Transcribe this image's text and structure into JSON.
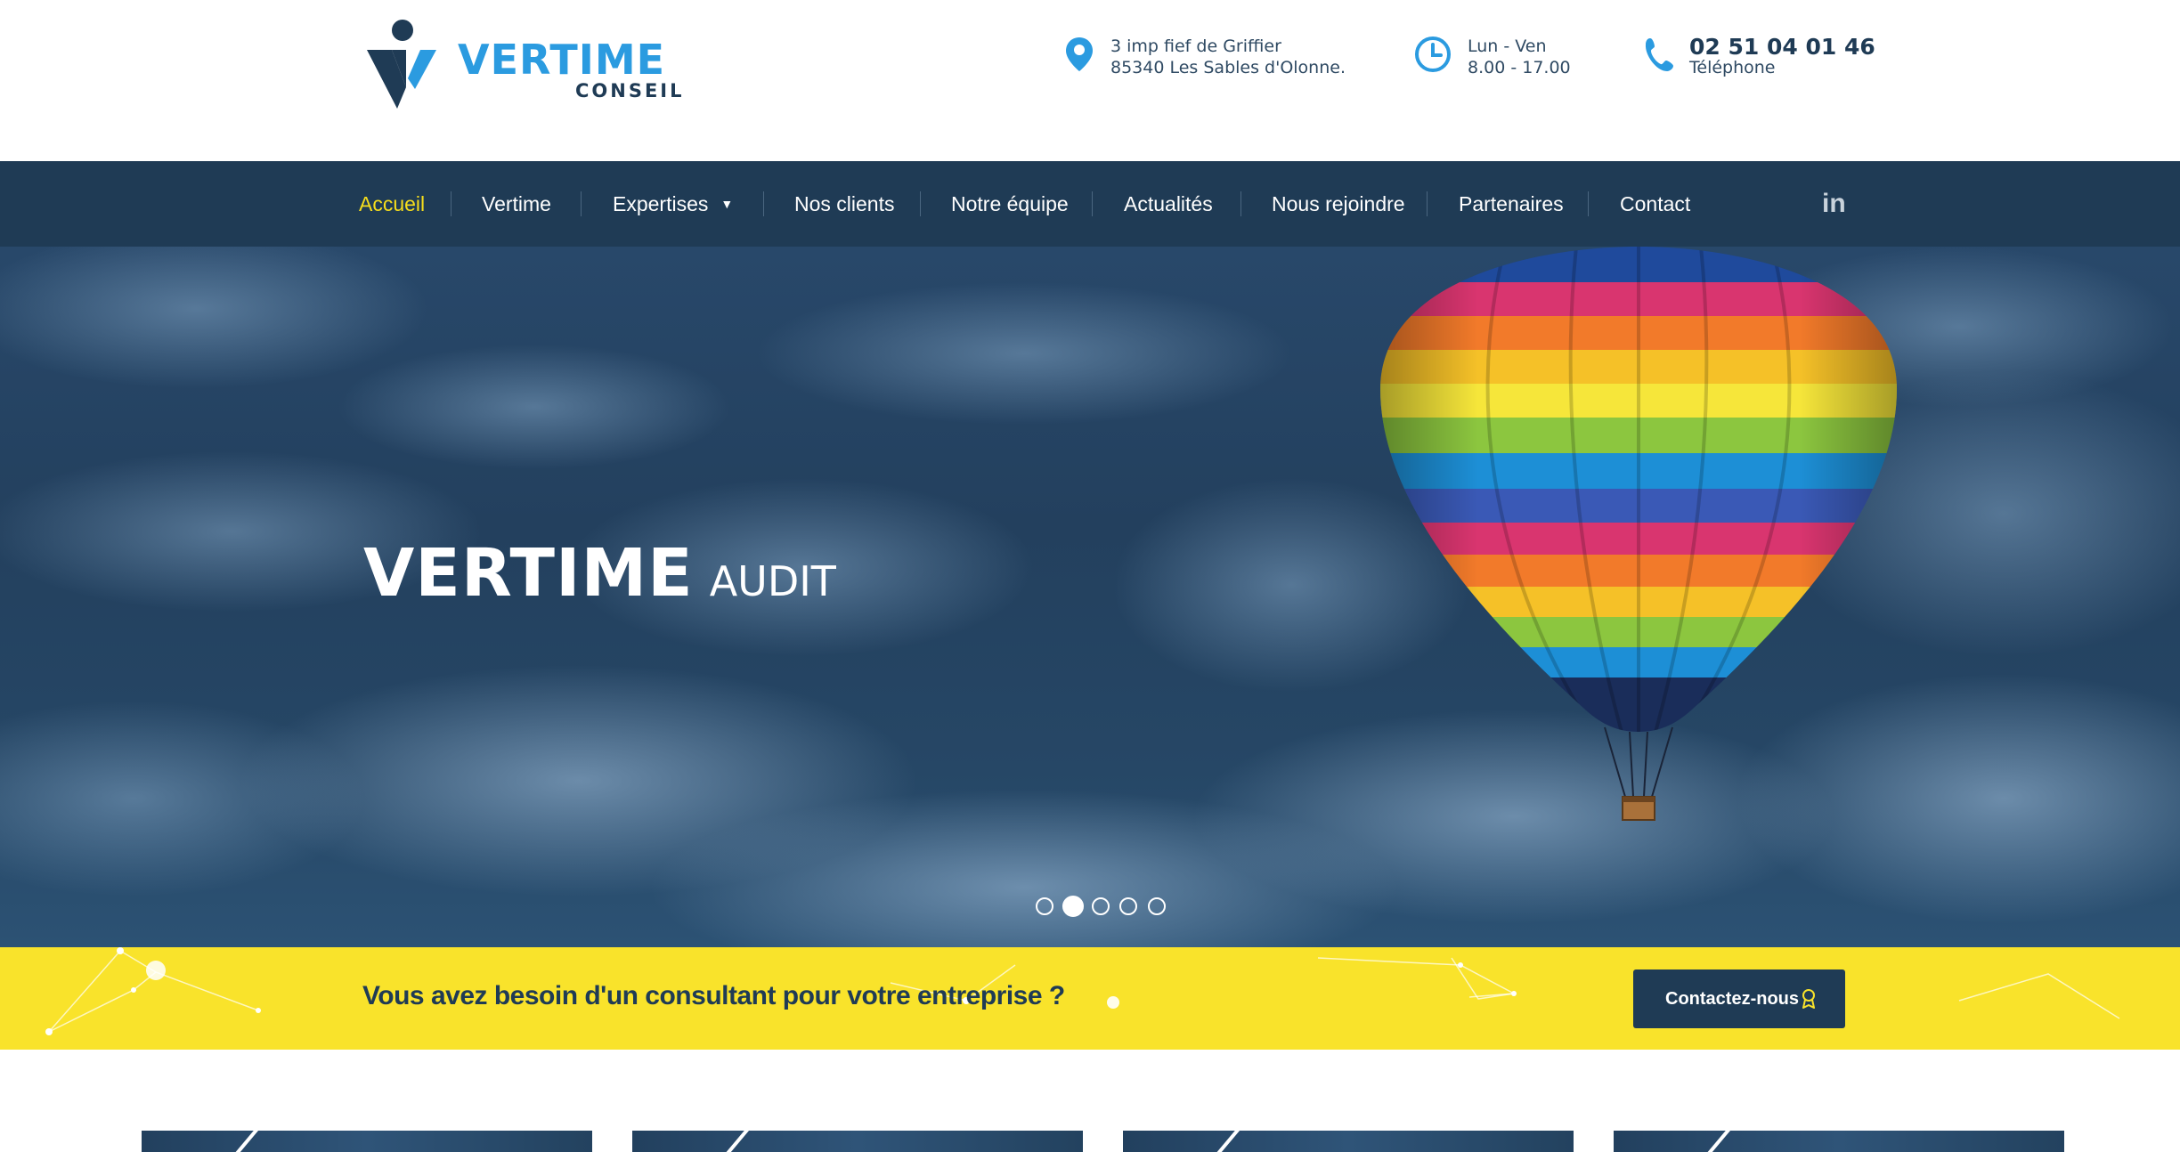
{
  "brand": {
    "name": "VERTIME",
    "subtitle": "CONSEIL"
  },
  "contact": {
    "address": {
      "line1": "3 imp fief de Griffier",
      "line2": "85340 Les Sables d'Olonne.",
      "icon": "map-pin-icon"
    },
    "hours": {
      "line1": "Lun - Ven",
      "line2": "8.00 - 17.00",
      "icon": "clock-icon"
    },
    "phone": {
      "number": "02 51 04 01 46",
      "label": "Téléphone",
      "icon": "phone-icon"
    }
  },
  "nav": {
    "items": [
      {
        "label": "Accueil",
        "active": true
      },
      {
        "label": "Vertime"
      },
      {
        "label": "Expertises",
        "dropdown": true
      },
      {
        "label": "Nos clients"
      },
      {
        "label": "Notre équipe"
      },
      {
        "label": "Actualités"
      },
      {
        "label": "Nous rejoindre"
      },
      {
        "label": "Partenaires"
      },
      {
        "label": "Contact"
      }
    ],
    "social": {
      "label": "in",
      "icon": "linkedin-icon"
    }
  },
  "hero": {
    "title": "VERTIME",
    "subtitle": "AUDIT",
    "slides": 5,
    "active_slide": 2
  },
  "cta": {
    "text": "Vous avez besoin d'un consultant pour votre entreprise ?",
    "button": "Contactez-nous",
    "button_icon": "award-icon"
  },
  "colors": {
    "navy": "#1f3b55",
    "brand_blue": "#2b9be0",
    "accent_yellow": "#f9e32b",
    "active_nav": "#f6dd1c"
  }
}
